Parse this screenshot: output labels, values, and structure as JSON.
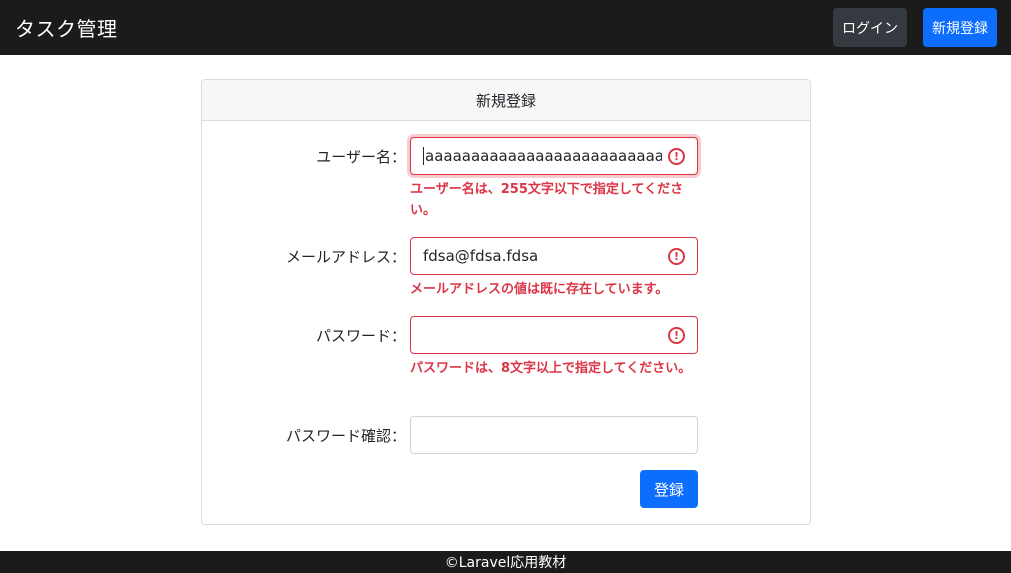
{
  "navbar": {
    "brand": "タスク管理",
    "login_label": "ログイン",
    "register_label": "新規登録"
  },
  "card": {
    "header": "新規登録",
    "fields": {
      "username": {
        "label": "ユーザー名：",
        "value": "aaaaaaaaaaaaaaaaaaaaaaaaaaaaaaaaaaaaa",
        "error": "ユーザー名は、255文字以下で指定してください。"
      },
      "email": {
        "label": "メールアドレス：",
        "value": "fdsa@fdsa.fdsa",
        "error": "メールアドレスの値は既に存在しています。"
      },
      "password": {
        "label": "パスワード：",
        "value": "",
        "error": "パスワードは、8文字以上で指定してください。"
      },
      "password_confirm": {
        "label": "パスワード確認：",
        "value": ""
      }
    },
    "submit_label": "登録"
  },
  "footer": {
    "text": "©Laravel応用教材"
  },
  "colors": {
    "navbar_bg": "#1b1b1b",
    "primary": "#0d6efd",
    "danger": "#dc3545"
  }
}
